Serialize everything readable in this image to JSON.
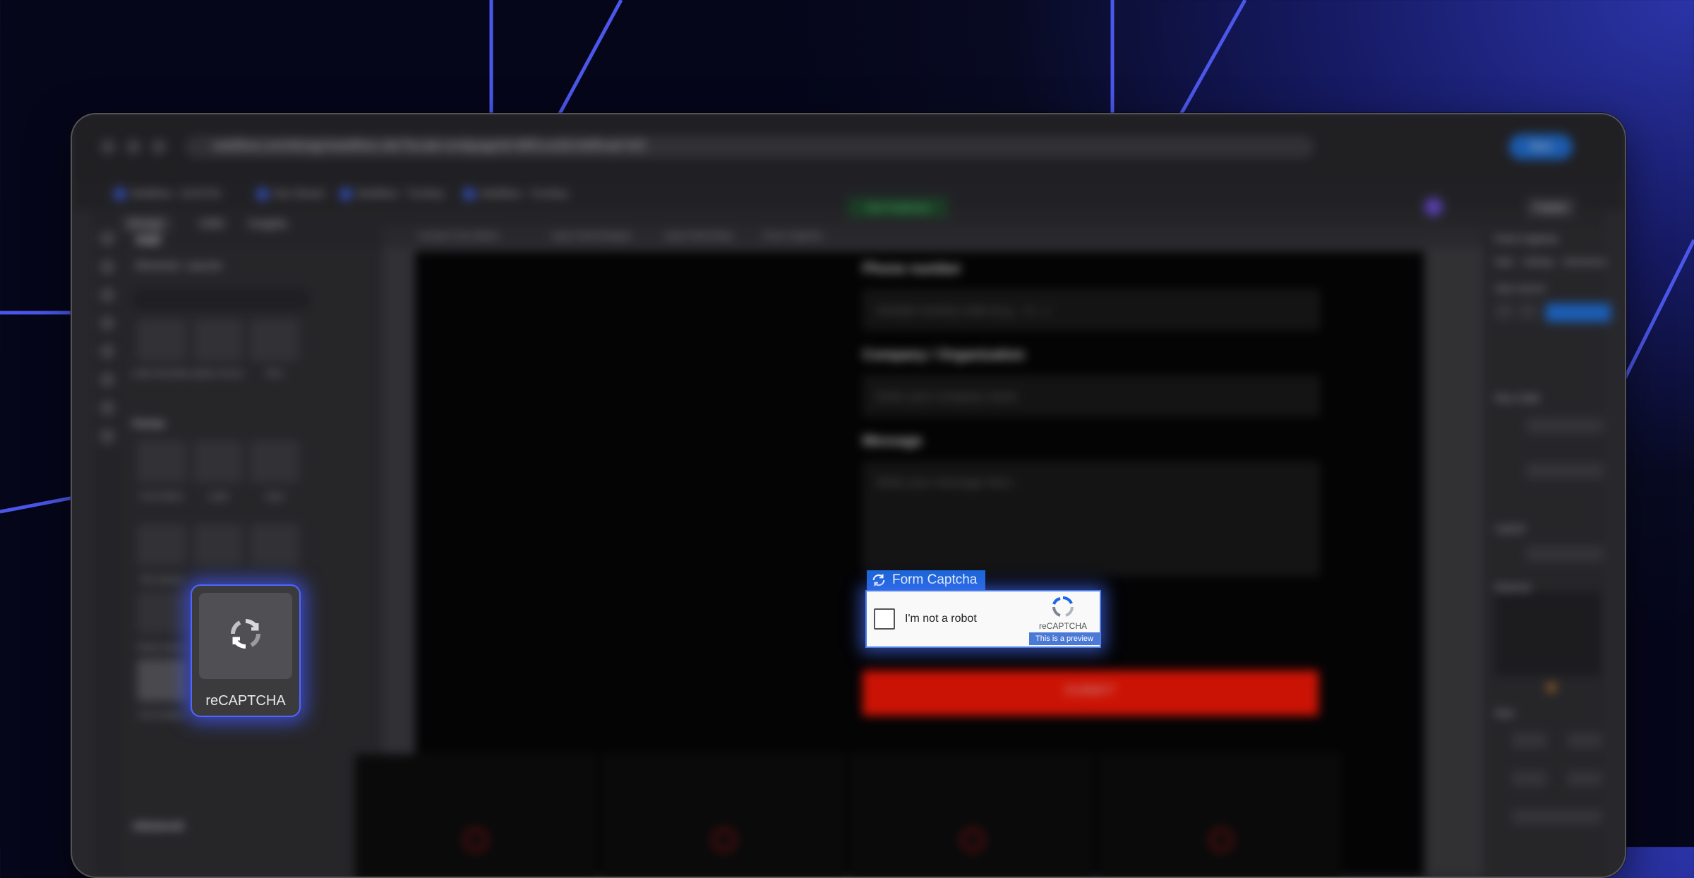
{
  "browser": {
    "url": "webflow.com/design/webflow-site?locale=en&pageId=68f1ca3d14d5fcab7ef2",
    "bookmarks": [
      "Webflow - DUSTIN",
      "Dev Board",
      "Webflow - Turnkey",
      "Webflow - Turnkey"
    ],
    "profile_label": "New"
  },
  "designer": {
    "topbar": [
      "Design",
      "CMS",
      "Insights"
    ],
    "status_badge": "Site Published",
    "publish_label": "Publish",
    "panel_title": "Add",
    "panel_tabs": [
      "Elements",
      "Layouts"
    ],
    "search_placeholder": "Search elements",
    "tiles_row1": [
      "Lottie Animation",
      "Spline Scene",
      "Rive"
    ],
    "section_forms": "Forms",
    "tiles_forms": [
      "Form Block",
      "Label",
      "Input"
    ],
    "tiles_row3": [
      "File Upload",
      "Text Area",
      "Checkbox"
    ],
    "tiles_row4": [
      "Radio Button",
      "Select"
    ],
    "tiles_row5": [
      "Form Button"
    ],
    "section_advanced": "Advanced",
    "breadcrumbs": [
      "Contact Form Block",
      "Input Field Wrapper",
      "Input Field Wrap",
      "Form Captcha"
    ],
    "right_panel": {
      "title": "Form Captcha",
      "tabs": [
        "Style",
        "Settings",
        "Interactions"
      ],
      "labels": [
        "Style selector",
        "Flex Child",
        "Layout",
        "Spacing",
        "Size"
      ],
      "selector_chip": "Form Captcha"
    }
  },
  "form": {
    "phone_label": "Phone number",
    "phone_placeholder": "Include country code (e.g., +1...)",
    "company_label": "Company / Organization",
    "company_placeholder": "Enter your company name",
    "message_label": "Message",
    "message_placeholder": "Write your message here...",
    "submit_label": "SUBMIT"
  },
  "captcha": {
    "tag_label": "Form Captcha",
    "checkbox_label": "I'm not a robot",
    "brand": "reCAPTCHA",
    "preview_label": "This is a preview"
  },
  "drag_card": {
    "label": "reCAPTCHA"
  },
  "colors": {
    "accent_blue": "#1d66d8",
    "submit_red": "#ff1400",
    "glow": "#4f66ff"
  }
}
